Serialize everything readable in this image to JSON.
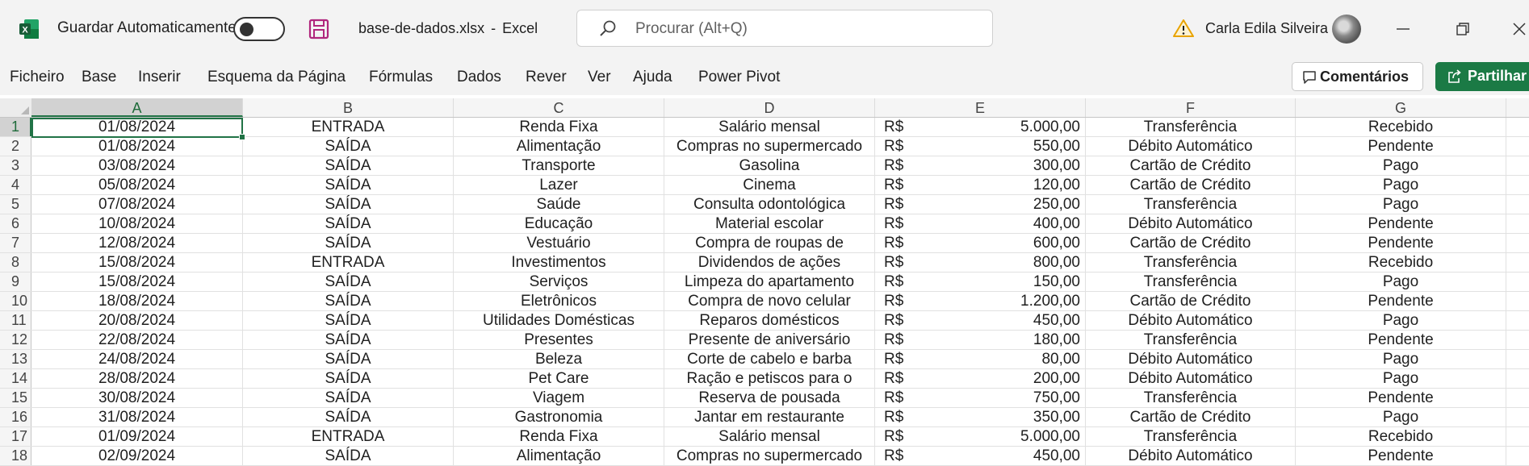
{
  "titlebar": {
    "autosave_label": "Guardar Automaticamente",
    "filename": "base-de-dados.xlsx",
    "separator": "-",
    "app_name": "Excel",
    "search_placeholder": "Procurar (Alt+Q)",
    "username": "Carla Edila Silveira"
  },
  "ribbon": {
    "menu": [
      "Ficheiro",
      "Base",
      "Inserir",
      "Esquema da Página",
      "Fórmulas",
      "Dados",
      "Rever",
      "Ver",
      "Ajuda",
      "Power Pivot"
    ],
    "comments_label": "Comentários",
    "share_label": "Partilhar"
  },
  "colors": {
    "excel_green": "#217346",
    "share_green": "#1b7a45",
    "save_purple": "#b0267d",
    "warning": "#e8a300"
  },
  "grid": {
    "columns": [
      "A",
      "B",
      "C",
      "D",
      "E",
      "F",
      "G"
    ],
    "selected_column": "A",
    "active_cell": "A1",
    "rows": [
      {
        "n": "1",
        "a": "01/08/2024",
        "b": "ENTRADA",
        "c": "Renda Fixa",
        "d": "Salário mensal",
        "cur": "R$",
        "e": "5.000,00",
        "f": "Transferência",
        "g": "Recebido"
      },
      {
        "n": "2",
        "a": "01/08/2024",
        "b": "SAÍDA",
        "c": "Alimentação",
        "d": "Compras no supermercado",
        "cur": "R$",
        "e": "550,00",
        "f": "Débito Automático",
        "g": "Pendente"
      },
      {
        "n": "3",
        "a": "03/08/2024",
        "b": "SAÍDA",
        "c": "Transporte",
        "d": "Gasolina",
        "cur": "R$",
        "e": "300,00",
        "f": "Cartão de Crédito",
        "g": "Pago"
      },
      {
        "n": "4",
        "a": "05/08/2024",
        "b": "SAÍDA",
        "c": "Lazer",
        "d": "Cinema",
        "cur": "R$",
        "e": "120,00",
        "f": "Cartão de Crédito",
        "g": "Pago"
      },
      {
        "n": "5",
        "a": "07/08/2024",
        "b": "SAÍDA",
        "c": "Saúde",
        "d": "Consulta odontológica",
        "cur": "R$",
        "e": "250,00",
        "f": "Transferência",
        "g": "Pago"
      },
      {
        "n": "6",
        "a": "10/08/2024",
        "b": "SAÍDA",
        "c": "Educação",
        "d": "Material escolar",
        "cur": "R$",
        "e": "400,00",
        "f": "Débito Automático",
        "g": "Pendente"
      },
      {
        "n": "7",
        "a": "12/08/2024",
        "b": "SAÍDA",
        "c": "Vestuário",
        "d": "Compra de roupas de",
        "cur": "R$",
        "e": "600,00",
        "f": "Cartão de Crédito",
        "g": "Pendente"
      },
      {
        "n": "8",
        "a": "15/08/2024",
        "b": "ENTRADA",
        "c": "Investimentos",
        "d": "Dividendos de ações",
        "cur": "R$",
        "e": "800,00",
        "f": "Transferência",
        "g": "Recebido"
      },
      {
        "n": "9",
        "a": "15/08/2024",
        "b": "SAÍDA",
        "c": "Serviços",
        "d": "Limpeza do apartamento",
        "cur": "R$",
        "e": "150,00",
        "f": "Transferência",
        "g": "Pago"
      },
      {
        "n": "10",
        "a": "18/08/2024",
        "b": "SAÍDA",
        "c": "Eletrônicos",
        "d": "Compra de novo celular",
        "cur": "R$",
        "e": "1.200,00",
        "f": "Cartão de Crédito",
        "g": "Pendente"
      },
      {
        "n": "11",
        "a": "20/08/2024",
        "b": "SAÍDA",
        "c": "Utilidades Domésticas",
        "d": "Reparos domésticos",
        "cur": "R$",
        "e": "450,00",
        "f": "Débito Automático",
        "g": "Pago"
      },
      {
        "n": "12",
        "a": "22/08/2024",
        "b": "SAÍDA",
        "c": "Presentes",
        "d": "Presente de aniversário",
        "cur": "R$",
        "e": "180,00",
        "f": "Transferência",
        "g": "Pendente"
      },
      {
        "n": "13",
        "a": "24/08/2024",
        "b": "SAÍDA",
        "c": "Beleza",
        "d": "Corte de cabelo e barba",
        "cur": "R$",
        "e": "80,00",
        "f": "Débito Automático",
        "g": "Pago"
      },
      {
        "n": "14",
        "a": "28/08/2024",
        "b": "SAÍDA",
        "c": "Pet Care",
        "d": "Ração e petiscos para o",
        "cur": "R$",
        "e": "200,00",
        "f": "Débito Automático",
        "g": "Pago"
      },
      {
        "n": "15",
        "a": "30/08/2024",
        "b": "SAÍDA",
        "c": "Viagem",
        "d": "Reserva de pousada",
        "cur": "R$",
        "e": "750,00",
        "f": "Transferência",
        "g": "Pendente"
      },
      {
        "n": "16",
        "a": "31/08/2024",
        "b": "SAÍDA",
        "c": "Gastronomia",
        "d": "Jantar em restaurante",
        "cur": "R$",
        "e": "350,00",
        "f": "Cartão de Crédito",
        "g": "Pago"
      },
      {
        "n": "17",
        "a": "01/09/2024",
        "b": "ENTRADA",
        "c": "Renda Fixa",
        "d": "Salário mensal",
        "cur": "R$",
        "e": "5.000,00",
        "f": "Transferência",
        "g": "Recebido"
      },
      {
        "n": "18",
        "a": "02/09/2024",
        "b": "SAÍDA",
        "c": "Alimentação",
        "d": "Compras no supermercado",
        "cur": "R$",
        "e": "450,00",
        "f": "Débito Automático",
        "g": "Pendente"
      }
    ]
  }
}
